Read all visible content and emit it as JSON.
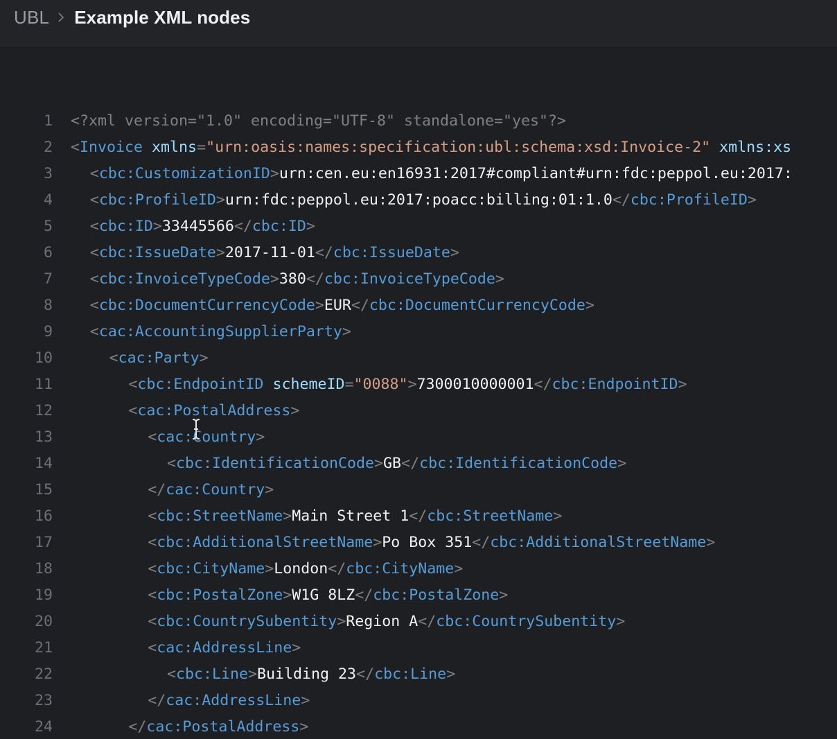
{
  "breadcrumb": {
    "root": "UBL",
    "current": "Example XML nodes"
  },
  "colors": {
    "background": "#1e1f22",
    "tag": "#569cd6",
    "attribute": "#9cdcfe",
    "string": "#d69d85",
    "punctuation": "#808080",
    "text": "#f2f2f2"
  },
  "code_lines": [
    {
      "n": "1",
      "indent": 0,
      "tokens": [
        [
          "p",
          "<?xml version=\"1.0\" encoding=\"UTF-8\" standalone=\"yes\"?>"
        ]
      ]
    },
    {
      "n": "2",
      "indent": 0,
      "tokens": [
        [
          "p",
          "<"
        ],
        [
          "t",
          "Invoice"
        ],
        [
          "v",
          " "
        ],
        [
          "a",
          "xmlns"
        ],
        [
          "p",
          "="
        ],
        [
          "s",
          "\"urn:oasis:names:specification:ubl:schema:xsd:Invoice-2\""
        ],
        [
          "v",
          " "
        ],
        [
          "a",
          "xmlns:xs"
        ]
      ]
    },
    {
      "n": "3",
      "indent": 1,
      "tokens": [
        [
          "p",
          "<"
        ],
        [
          "t",
          "cbc:CustomizationID"
        ],
        [
          "p",
          ">"
        ],
        [
          "v",
          "urn:cen.eu:en16931:2017#compliant#urn:fdc:peppol.eu:2017:"
        ]
      ]
    },
    {
      "n": "4",
      "indent": 1,
      "tokens": [
        [
          "p",
          "<"
        ],
        [
          "t",
          "cbc:ProfileID"
        ],
        [
          "p",
          ">"
        ],
        [
          "v",
          "urn:fdc:peppol.eu:2017:poacc:billing:01:1.0"
        ],
        [
          "p",
          "</"
        ],
        [
          "t",
          "cbc:ProfileID"
        ],
        [
          "p",
          ">"
        ]
      ]
    },
    {
      "n": "5",
      "indent": 1,
      "tokens": [
        [
          "p",
          "<"
        ],
        [
          "t",
          "cbc:ID"
        ],
        [
          "p",
          ">"
        ],
        [
          "v",
          "33445566"
        ],
        [
          "p",
          "</"
        ],
        [
          "t",
          "cbc:ID"
        ],
        [
          "p",
          ">"
        ]
      ]
    },
    {
      "n": "6",
      "indent": 1,
      "tokens": [
        [
          "p",
          "<"
        ],
        [
          "t",
          "cbc:IssueDate"
        ],
        [
          "p",
          ">"
        ],
        [
          "v",
          "2017-11-01"
        ],
        [
          "p",
          "</"
        ],
        [
          "t",
          "cbc:IssueDate"
        ],
        [
          "p",
          ">"
        ]
      ]
    },
    {
      "n": "7",
      "indent": 1,
      "tokens": [
        [
          "p",
          "<"
        ],
        [
          "t",
          "cbc:InvoiceTypeCode"
        ],
        [
          "p",
          ">"
        ],
        [
          "v",
          "380"
        ],
        [
          "p",
          "</"
        ],
        [
          "t",
          "cbc:InvoiceTypeCode"
        ],
        [
          "p",
          ">"
        ]
      ]
    },
    {
      "n": "8",
      "indent": 1,
      "tokens": [
        [
          "p",
          "<"
        ],
        [
          "t",
          "cbc:DocumentCurrencyCode"
        ],
        [
          "p",
          ">"
        ],
        [
          "v",
          "EUR"
        ],
        [
          "p",
          "</"
        ],
        [
          "t",
          "cbc:DocumentCurrencyCode"
        ],
        [
          "p",
          ">"
        ]
      ]
    },
    {
      "n": "9",
      "indent": 1,
      "tokens": [
        [
          "p",
          "<"
        ],
        [
          "t",
          "cac:AccountingSupplierParty"
        ],
        [
          "p",
          ">"
        ]
      ]
    },
    {
      "n": "10",
      "indent": 2,
      "tokens": [
        [
          "p",
          "<"
        ],
        [
          "t",
          "cac:Party"
        ],
        [
          "p",
          ">"
        ]
      ]
    },
    {
      "n": "11",
      "indent": 3,
      "tokens": [
        [
          "p",
          "<"
        ],
        [
          "t",
          "cbc:EndpointID"
        ],
        [
          "v",
          " "
        ],
        [
          "a",
          "schemeID"
        ],
        [
          "p",
          "="
        ],
        [
          "s",
          "\"0088\""
        ],
        [
          "p",
          ">"
        ],
        [
          "v",
          "7300010000001"
        ],
        [
          "p",
          "</"
        ],
        [
          "t",
          "cbc:EndpointID"
        ],
        [
          "p",
          ">"
        ]
      ]
    },
    {
      "n": "12",
      "indent": 3,
      "tokens": [
        [
          "p",
          "<"
        ],
        [
          "t",
          "cac:PostalAddress"
        ],
        [
          "p",
          ">"
        ]
      ]
    },
    {
      "n": "13",
      "indent": 4,
      "tokens": [
        [
          "p",
          "<"
        ],
        [
          "t",
          "cac:Country"
        ],
        [
          "p",
          ">"
        ]
      ]
    },
    {
      "n": "14",
      "indent": 5,
      "tokens": [
        [
          "p",
          "<"
        ],
        [
          "t",
          "cbc:IdentificationCode"
        ],
        [
          "p",
          ">"
        ],
        [
          "v",
          "GB"
        ],
        [
          "p",
          "</"
        ],
        [
          "t",
          "cbc:IdentificationCode"
        ],
        [
          "p",
          ">"
        ]
      ]
    },
    {
      "n": "15",
      "indent": 4,
      "tokens": [
        [
          "p",
          "</"
        ],
        [
          "t",
          "cac:Country"
        ],
        [
          "p",
          ">"
        ]
      ]
    },
    {
      "n": "16",
      "indent": 4,
      "tokens": [
        [
          "p",
          "<"
        ],
        [
          "t",
          "cbc:StreetName"
        ],
        [
          "p",
          ">"
        ],
        [
          "v",
          "Main Street 1"
        ],
        [
          "p",
          "</"
        ],
        [
          "t",
          "cbc:StreetName"
        ],
        [
          "p",
          ">"
        ]
      ]
    },
    {
      "n": "17",
      "indent": 4,
      "tokens": [
        [
          "p",
          "<"
        ],
        [
          "t",
          "cbc:AdditionalStreetName"
        ],
        [
          "p",
          ">"
        ],
        [
          "v",
          "Po Box 351"
        ],
        [
          "p",
          "</"
        ],
        [
          "t",
          "cbc:AdditionalStreetName"
        ],
        [
          "p",
          ">"
        ]
      ]
    },
    {
      "n": "18",
      "indent": 4,
      "tokens": [
        [
          "p",
          "<"
        ],
        [
          "t",
          "cbc:CityName"
        ],
        [
          "p",
          ">"
        ],
        [
          "v",
          "London"
        ],
        [
          "p",
          "</"
        ],
        [
          "t",
          "cbc:CityName"
        ],
        [
          "p",
          ">"
        ]
      ]
    },
    {
      "n": "19",
      "indent": 4,
      "tokens": [
        [
          "p",
          "<"
        ],
        [
          "t",
          "cbc:PostalZone"
        ],
        [
          "p",
          ">"
        ],
        [
          "v",
          "W1G 8LZ"
        ],
        [
          "p",
          "</"
        ],
        [
          "t",
          "cbc:PostalZone"
        ],
        [
          "p",
          ">"
        ]
      ]
    },
    {
      "n": "20",
      "indent": 4,
      "tokens": [
        [
          "p",
          "<"
        ],
        [
          "t",
          "cbc:CountrySubentity"
        ],
        [
          "p",
          ">"
        ],
        [
          "v",
          "Region A"
        ],
        [
          "p",
          "</"
        ],
        [
          "t",
          "cbc:CountrySubentity"
        ],
        [
          "p",
          ">"
        ]
      ]
    },
    {
      "n": "21",
      "indent": 4,
      "tokens": [
        [
          "p",
          "<"
        ],
        [
          "t",
          "cac:AddressLine"
        ],
        [
          "p",
          ">"
        ]
      ]
    },
    {
      "n": "22",
      "indent": 5,
      "tokens": [
        [
          "p",
          "<"
        ],
        [
          "t",
          "cbc:Line"
        ],
        [
          "p",
          ">"
        ],
        [
          "v",
          "Building 23"
        ],
        [
          "p",
          "</"
        ],
        [
          "t",
          "cbc:Line"
        ],
        [
          "p",
          ">"
        ]
      ]
    },
    {
      "n": "23",
      "indent": 4,
      "tokens": [
        [
          "p",
          "</"
        ],
        [
          "t",
          "cac:AddressLine"
        ],
        [
          "p",
          ">"
        ]
      ]
    },
    {
      "n": "24",
      "indent": 3,
      "tokens": [
        [
          "p",
          "</"
        ],
        [
          "t",
          "cac:PostalAddress"
        ],
        [
          "p",
          ">"
        ]
      ]
    }
  ]
}
